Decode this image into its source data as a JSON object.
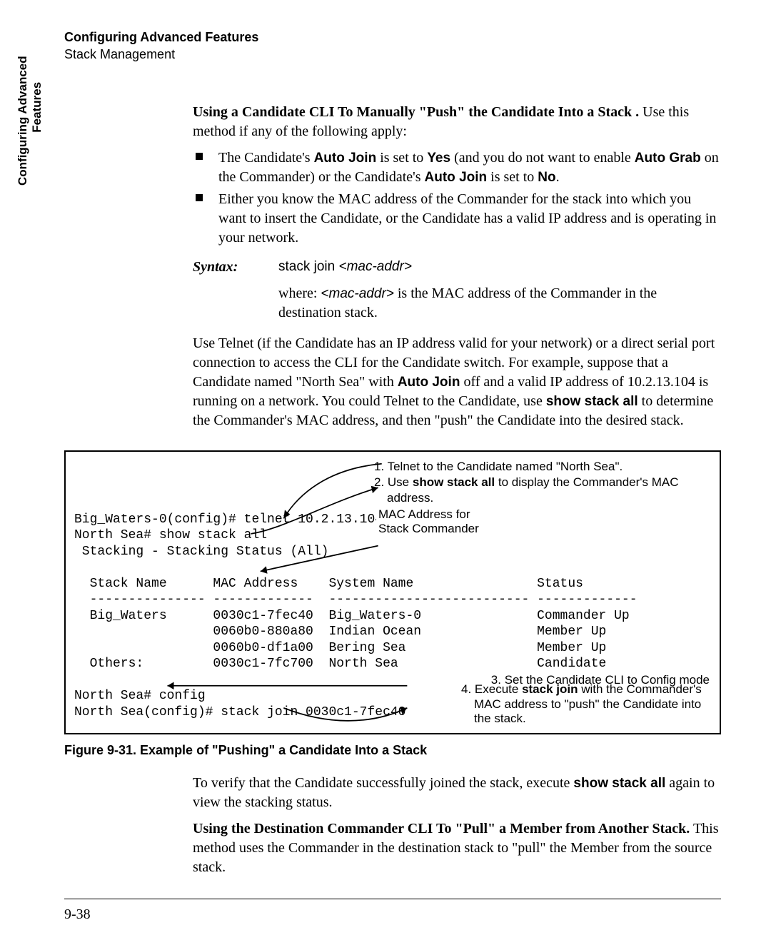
{
  "running_head": {
    "title": "Configuring Advanced Features",
    "subtitle": "Stack Management"
  },
  "side_tab": "Configuring Advanced\n        Features",
  "section1": {
    "lead_bold": "Using a Candidate CLI To Manually \"Push\" the Candidate Into a Stack .",
    "lead_rest": "  Use this method if any of the following apply:",
    "bullet1_a": "The Candidate's ",
    "bullet1_b": "Auto Join",
    "bullet1_c": " is set to ",
    "bullet1_d": "Yes",
    "bullet1_e": " (and  you do not want to enable ",
    "bullet1_f": "Auto Grab",
    "bullet1_g": " on the Commander) or the Candidate's ",
    "bullet1_h": "Auto Join",
    "bullet1_i": " is set to ",
    "bullet1_j": "No",
    "bullet1_k": ".",
    "bullet2": "Either you know the MAC address of the Commander for the stack into which you want to insert the Candidate, or the Candidate has a valid IP address and is operating in your network."
  },
  "syntax": {
    "label": "Syntax:",
    "cmd_plain": "stack join ",
    "cmd_arg": "<mac-addr>",
    "desc_a": "where: ",
    "desc_b": "<mac-addr>",
    "desc_c": " is the MAC address of the Commander in the destination stack."
  },
  "para2_a": "Use Telnet (if the Candidate has an IP address valid for your network) or a direct serial port connection to access the CLI for the Candidate switch. For example, suppose that a Candidate named \"North Sea\" with ",
  "para2_b": "Auto Join",
  "para2_c": " off and a valid IP address of 10.2.13.104 is running on a network. You could Telnet to the Candidate, use ",
  "para2_d": "show stack all",
  "para2_e": " to determine the Commander's MAC address, and then \"push\" the Candidate into the desired stack.",
  "figure": {
    "ann1": "1.  Telnet to the Candidate named \"North Sea\".",
    "ann2a": "2.  Use ",
    "ann2b": "show stack all",
    "ann2c": " to display the Commander's MAC address.",
    "mac_label": "MAC Address for\nStack Commander",
    "terminal": "Big_Waters-0(config)# telnet 10.2.13.104\nNorth Sea# show stack all\n Stacking - Stacking Status (All)\n\n  Stack Name      MAC Address    System Name                Status\n  --------------- -------------  -------------------------- -------------\n  Big_Waters      0030c1-7fec40  Big_Waters-0               Commander Up\n                  0060b0-880a80  Indian Ocean               Member Up\n                  0060b0-df1a00  Bering Sea                 Member Up\n  Others:         0030c1-7fc700  North Sea                  Candidate\n\nNorth Sea# config\nNorth Sea(config)# stack join 0030c1-7fec40",
    "ann3": "3.  Set the Candidate CLI to Config mode",
    "ann4a": "4.  Execute ",
    "ann4b": "stack join",
    "ann4c": " with the Commander's MAC address to \"push\" the Candidate into the stack.",
    "caption": "Figure 9-31.  Example of \"Pushing\" a Candidate Into a Stack"
  },
  "chart_data": {
    "type": "table",
    "title": "Stacking - Stacking Status (All)",
    "columns": [
      "Stack Name",
      "MAC Address",
      "System Name",
      "Status"
    ],
    "rows": [
      [
        "Big_Waters",
        "0030c1-7fec40",
        "Big_Waters-0",
        "Commander Up"
      ],
      [
        "",
        "0060b0-880a80",
        "Indian Ocean",
        "Member Up"
      ],
      [
        "",
        "0060b0-df1a00",
        "Bering Sea",
        "Member Up"
      ],
      [
        "Others:",
        "0030c1-7fc700",
        "North Sea",
        "Candidate"
      ]
    ]
  },
  "para3_a": "To verify that the Candidate successfully joined the stack, execute ",
  "para3_b": "show stack all",
  "para3_c": " again to view the stacking status.",
  "section2": {
    "lead_bold": "Using the Destination Commander CLI To \"Pull\" a Member from Another Stack.",
    "lead_rest": "  This method uses the Commander in the destination stack to \"pull\" the Member from the source stack."
  },
  "page_number": "9-38"
}
